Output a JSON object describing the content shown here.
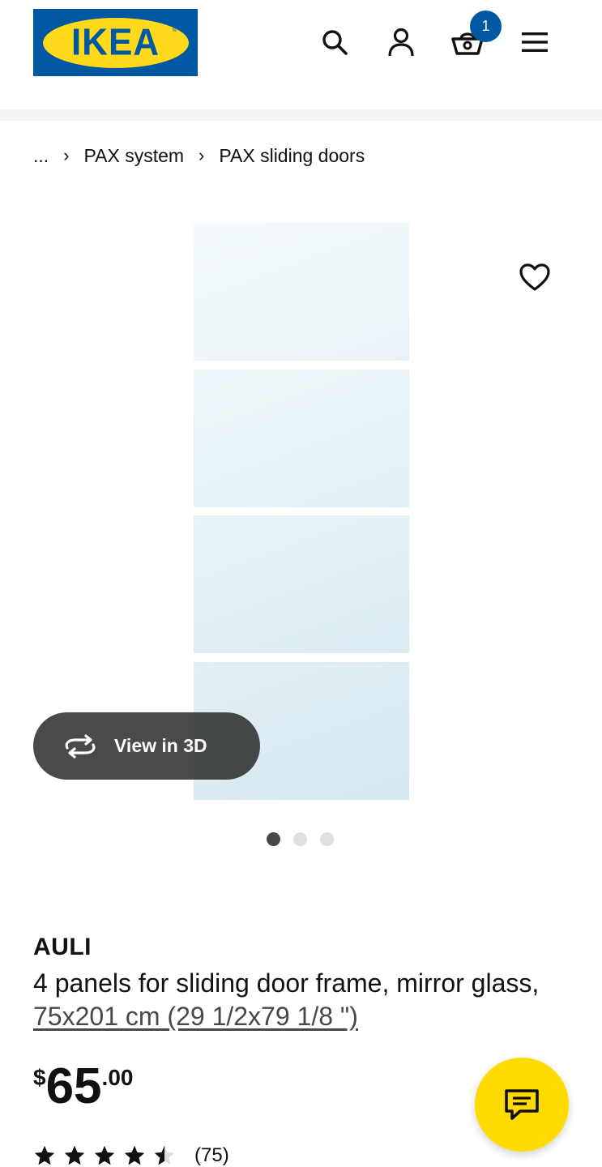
{
  "header": {
    "logo_text": "IKEA",
    "logo_reg": "®",
    "cart_count": "1",
    "icons": [
      "search-icon",
      "profile-icon",
      "shopping-bag-icon",
      "hamburger-menu-icon"
    ],
    "brand_blue": "#0058a3",
    "brand_yellow": "#ffda1a"
  },
  "breadcrumb": {
    "ellipsis": "...",
    "items": [
      "PAX system",
      "PAX sliding doors"
    ],
    "separator": "›"
  },
  "gallery": {
    "view3d_label": "View in 3D",
    "slide_count": 3,
    "active_slide": 1
  },
  "product": {
    "name": "AULI",
    "description": "4 panels for sliding door frame, mirror glass, ",
    "measurement": "75x201 cm (29 1/2x79 1/8 \")",
    "price_currency": "$",
    "price_integer": "65",
    "price_decimal": ".00",
    "rating_value": 4.5,
    "rating_max": 5,
    "review_count": "(75)"
  },
  "chat": {
    "icon": "chat-bubble-icon",
    "color": "#ffdb00"
  }
}
